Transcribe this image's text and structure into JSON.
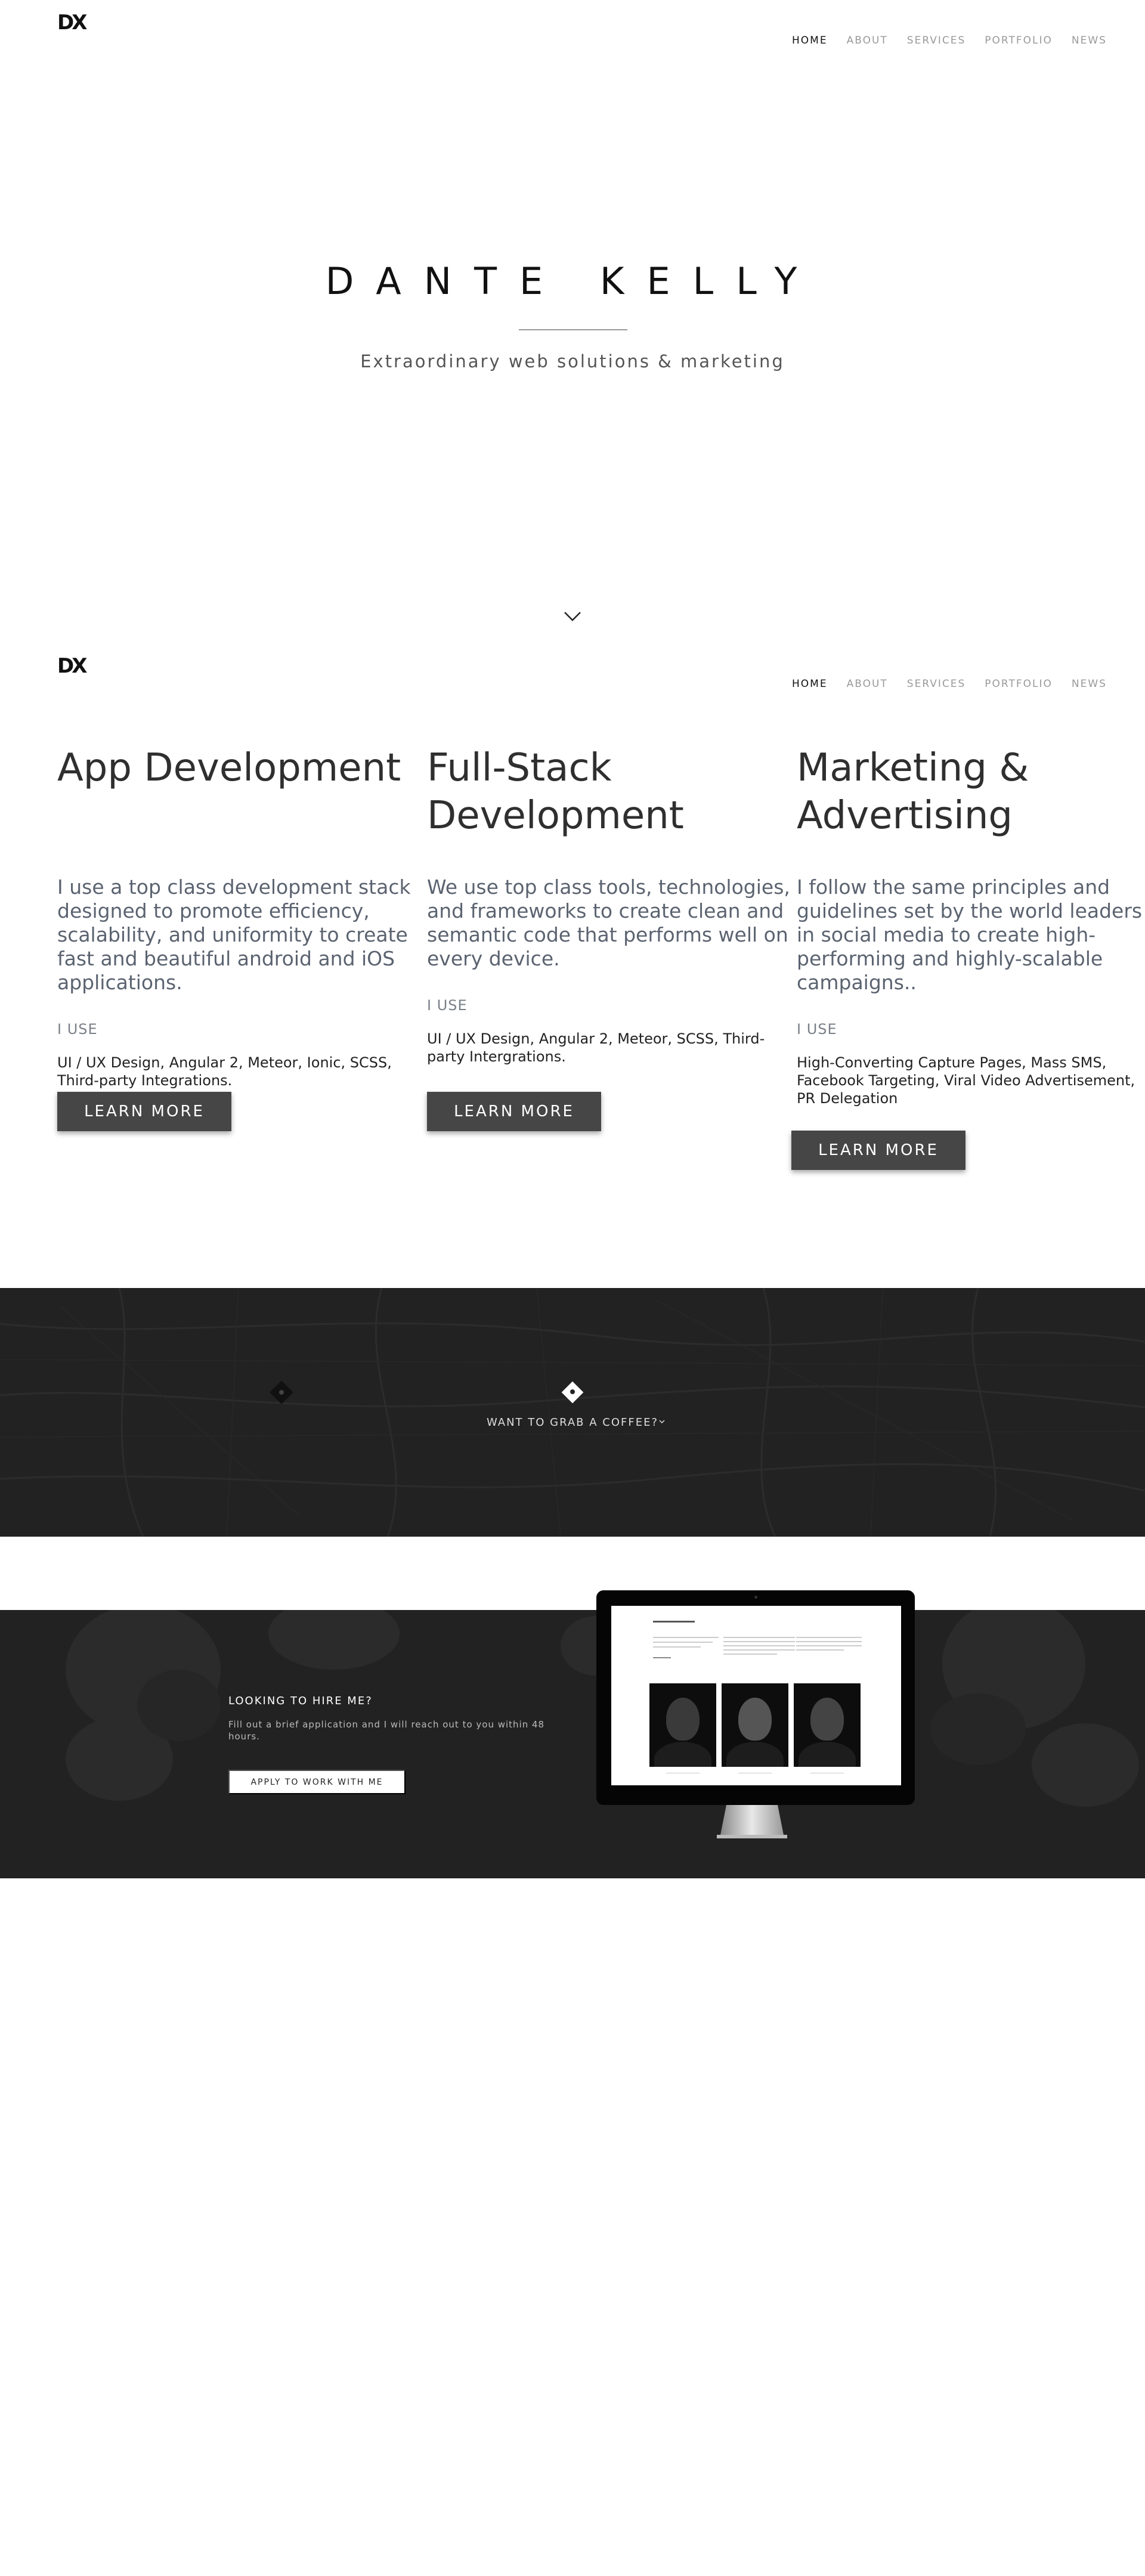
{
  "brand": {
    "logo": "DX"
  },
  "nav": {
    "items": [
      {
        "label": "HOME",
        "active": true
      },
      {
        "label": "ABOUT",
        "active": false
      },
      {
        "label": "SERVICES",
        "active": false
      },
      {
        "label": "PORTFOLIO",
        "active": false
      },
      {
        "label": "NEWS",
        "active": false
      }
    ]
  },
  "hero": {
    "title": "DANTE KELLY",
    "subtitle": "Extraordinary web solutions & marketing",
    "scroll_icon": "chevron-down-icon"
  },
  "services": [
    {
      "title": "App Development",
      "description": "I use a top class development stack designed to promote efficiency, scalability, and uniformity to create fast and beautiful android and iOS applications.",
      "use_label": "I USE",
      "tools": "UI / UX Design, Angular 2, Meteor, Ionic, SCSS, Third-party Integrations.",
      "button": "LEARN MORE"
    },
    {
      "title": "Full-Stack Development",
      "description": "We use top class tools, technologies, and frameworks to create clean and semantic code that performs well on every device.",
      "use_label": "I USE",
      "tools": "UI / UX Design, Angular 2, Meteor, SCSS, Third-party Intergrations.",
      "button": "LEARN MORE"
    },
    {
      "title": "Marketing & Advertising",
      "description": "I follow the same principles and guidelines set by the world leaders in social media to create high-performing and highly-scalable campaigns..",
      "use_label": "I USE",
      "tools": "High-Converting Capture Pages, Mass SMS, Facebook Targeting, Viral Video Advertisement, PR Delegation",
      "button": "LEARN MORE"
    }
  ],
  "coffee": {
    "link": "WANT TO GRAB A COFFEE?",
    "icon": "map-pin-icon",
    "colors": {
      "band": "#222222"
    }
  },
  "hire": {
    "title": "LOOKING TO HIRE ME?",
    "text": "Fill out a brief application and I will reach out to you within 48 hours.",
    "button": "APPLY TO WORK WITH ME"
  },
  "colors": {
    "button_dark": "#464646",
    "text_muted": "#5b6370"
  }
}
